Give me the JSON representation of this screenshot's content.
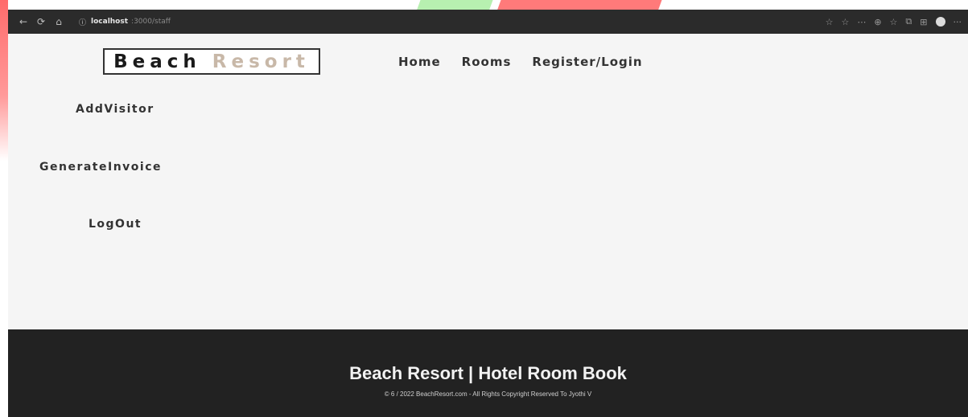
{
  "browser": {
    "back_icon": "←",
    "refresh_icon": "⟳",
    "home_icon": "⌂",
    "url_host": "localhost",
    "url_path": ":3000/staff",
    "toolbar_icons": [
      "☆",
      "☆",
      "⋯",
      "⊕",
      "☆",
      "⧉",
      "⊞"
    ],
    "more_icon": "···"
  },
  "header": {
    "logo_first": "Beach",
    "logo_second": "Resort",
    "nav": [
      "Home",
      "Rooms",
      "Register/Login"
    ]
  },
  "sidebar": {
    "items": [
      "AddVisitor",
      "GenerateInvoice",
      "LogOut"
    ]
  },
  "footer": {
    "title": "Beach Resort | Hotel Room Book",
    "copyright": "© 6 / 2022 BeachResort.com - All Rights Copyright Reserved To Jyothi V"
  }
}
